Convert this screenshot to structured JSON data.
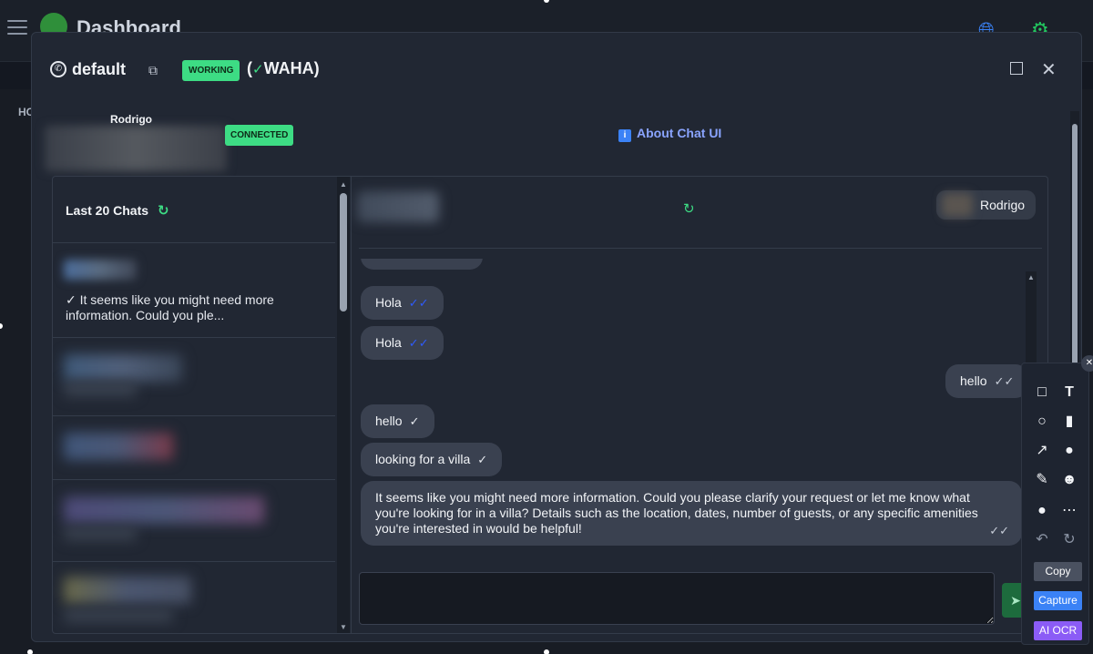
{
  "background": {
    "title": "Dashboard",
    "side_text": "HO"
  },
  "modal": {
    "session_name": "default",
    "status_badge": "WORKING",
    "engine_label": "WAHA)",
    "engine_prefix": "(",
    "profile_name": "Rodrigo",
    "connection_badge": "CONNECTED",
    "about_link": "About Chat UI",
    "about_icon": "i"
  },
  "chats": {
    "header": "Last 20 Chats",
    "first_preview": "It seems like you might need more information. Could you ple..."
  },
  "conversation": {
    "user_name": "Rodrigo",
    "messages": [
      {
        "text": "Hola",
        "direction": "in",
        "status": "read"
      },
      {
        "text": "Hola",
        "direction": "in",
        "status": "read"
      },
      {
        "text": "hello",
        "direction": "out",
        "status": "delivered"
      },
      {
        "text": "hello",
        "direction": "in",
        "status": "sent"
      },
      {
        "text": "looking for a villa",
        "direction": "in",
        "status": "sent"
      },
      {
        "text": "It seems like you might need more information. Could you please clarify your request or let me know what you're looking for in a villa? Details such as the location, dates, number of guests, or any specific amenities you're interested in would be helpful!",
        "direction": "in",
        "status": "delivered"
      }
    ],
    "compose_placeholder": ""
  },
  "toolbar": {
    "copy": "Copy",
    "capture": "Capture",
    "ai_ocr": "AI OCR",
    "icons": [
      "rectangle-icon",
      "text-icon",
      "circle-icon",
      "comment-icon",
      "arrow-icon",
      "info-icon",
      "pencil-icon",
      "emoji-icon",
      "drop-icon",
      "more-icon",
      "undo-icon",
      "redo-icon"
    ]
  },
  "colors": {
    "badge_green": "#3ddc84",
    "link_blue": "#8aa4ff",
    "read_tick": "#2e5bff",
    "capture_blue": "#3b82f6",
    "ocr_purple": "#8b5cf6"
  }
}
